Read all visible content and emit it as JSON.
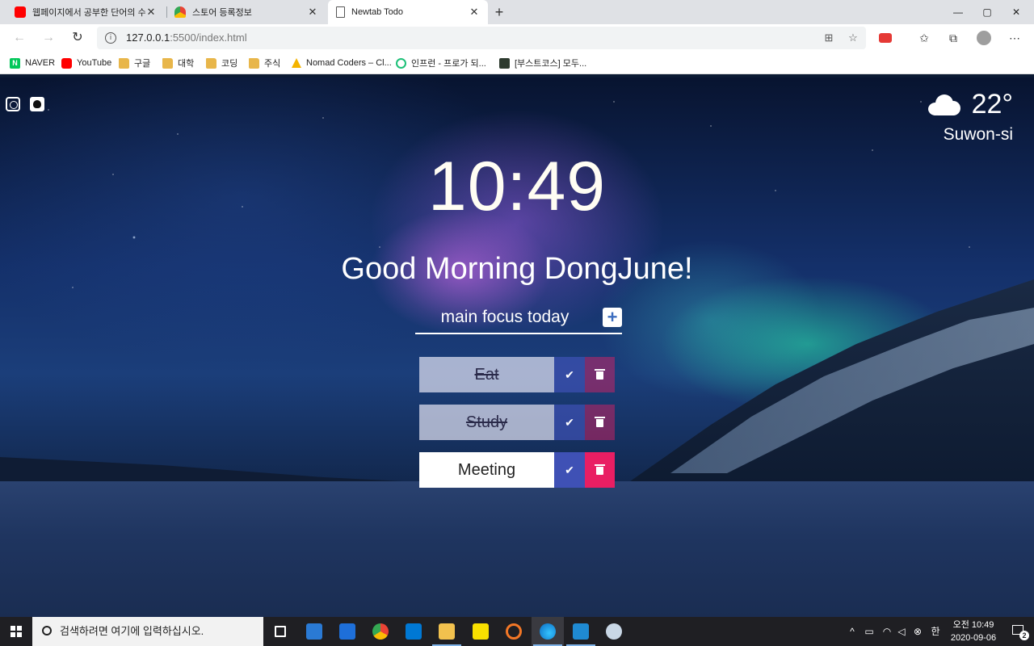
{
  "browser": {
    "tabs": [
      {
        "title": "웹페이지에서 공부한 단어의 수를",
        "icon": "youtube-icon",
        "color": "#ff0000"
      },
      {
        "title": "스토어 등록정보",
        "icon": "chrome-webstore-icon",
        "color": "#4caf50"
      },
      {
        "title": "Newtab Todo",
        "icon": "page-icon",
        "color": "#ffffff",
        "active": true
      }
    ],
    "new_tab": "+",
    "window_controls": {
      "minimize": "—",
      "maximize": "▢",
      "close": "✕"
    },
    "url": {
      "host": "127.0.0.1",
      "rest": ":5500/index.html"
    },
    "bookmarks": [
      {
        "label": "NAVER",
        "icon": "naver-icon"
      },
      {
        "label": "YouTube",
        "icon": "youtube-icon"
      },
      {
        "label": "구글",
        "icon": "folder-icon"
      },
      {
        "label": "대학",
        "icon": "folder-icon"
      },
      {
        "label": "코딩",
        "icon": "folder-icon"
      },
      {
        "label": "주식",
        "icon": "folder-icon"
      },
      {
        "label": "Nomad Coders – Cl...",
        "icon": "nomad-icon"
      },
      {
        "label": "인프런 - 프로가 되...",
        "icon": "inflearn-icon"
      },
      {
        "label": "[부스트코스] 모두...",
        "icon": "boostcourse-icon"
      }
    ]
  },
  "page": {
    "weather": {
      "temp": "22°",
      "city": "Suwon-si",
      "icon": "cloud-icon"
    },
    "clock": "10:49",
    "greeting": "Good Morning DongJune!",
    "input_placeholder": "main focus today",
    "todos": [
      {
        "text": "Eat",
        "done": true
      },
      {
        "text": "Study",
        "done": true
      },
      {
        "text": "Meeting",
        "done": false
      }
    ],
    "colors": {
      "check": "#3f51b5",
      "delete": "#e91e63"
    }
  },
  "taskbar": {
    "search_placeholder": "검색하려면 여기에 입력하십시오.",
    "time": "오전 10:49",
    "date": "2020-09-06",
    "ime": "한",
    "notification_count": "2"
  }
}
